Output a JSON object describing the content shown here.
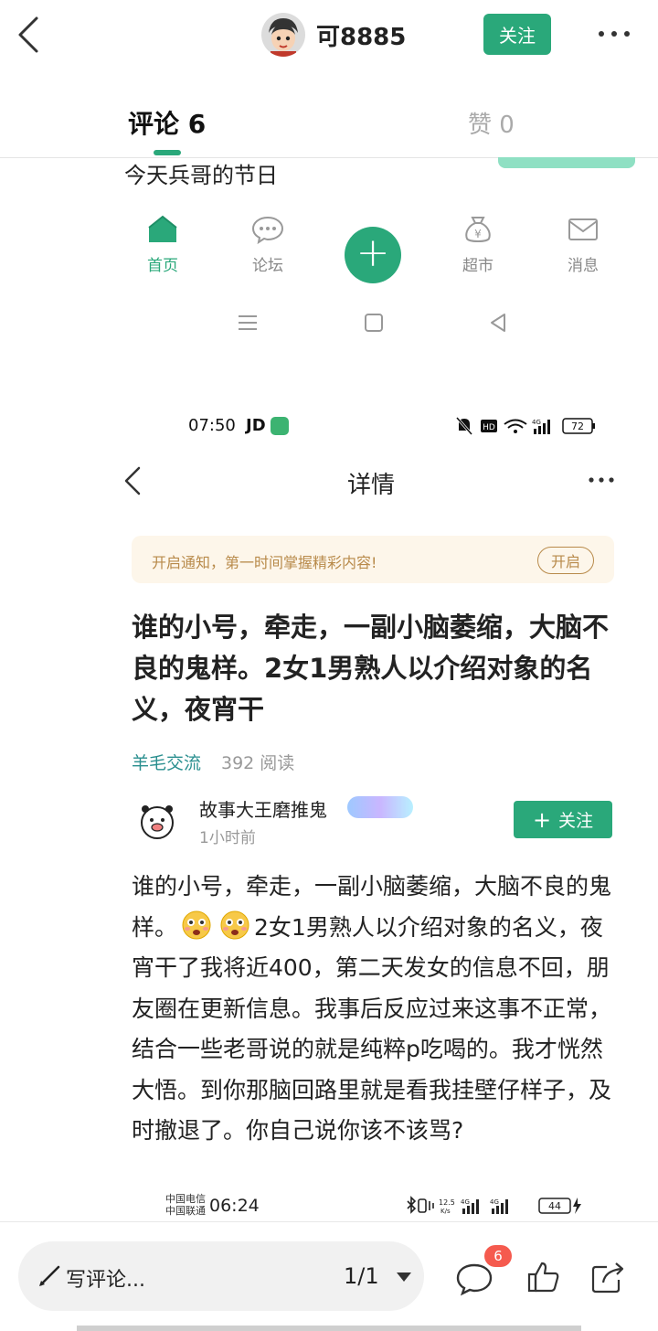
{
  "header": {
    "user_name": "可8885",
    "follow_label": "关注"
  },
  "tabs": {
    "comment_label": "评论 6",
    "like_label": "赞 0"
  },
  "embedded_top": {
    "snippet": "今天兵哥的节日",
    "nav": [
      {
        "label": "首页",
        "icon": "home-icon"
      },
      {
        "label": "论坛",
        "icon": "chat-bubble-icon"
      },
      {
        "label": "超市",
        "icon": "money-bag-icon"
      },
      {
        "label": "消息",
        "icon": "mail-icon"
      }
    ],
    "accent": "#2aa87a"
  },
  "status_bar_1": {
    "time": "07:50",
    "app": "JD",
    "battery": "72"
  },
  "detail": {
    "title": "详情",
    "notice_text": "开启通知，第一时间掌握精彩内容!",
    "notice_button": "开启",
    "post_title": "谁的小号，牵走，一副小脑萎缩，大脑不良的鬼样。2女1男熟人以介绍对象的名义，夜宵干",
    "forum": "羊毛交流",
    "read_count": "392 阅读",
    "author": "故事大王磨推鬼",
    "author_time": "1小时前",
    "follow_label": "关注",
    "body_part1": "谁的小号，牵走，一副小脑萎缩，大脑不良的鬼样。",
    "body_part2": "2女1男熟人以介绍对象的名义，夜宵干了我将近400，第二天发女的信息不回，朋友圈在更新信息。我事后反应过来这事不正常，结合一些老哥说的就是纯粹p吃喝的。我才恍然大悟。到你那脑回路里就是看我挂壁仔样子，及时撤退了。你自己说你该不该骂?"
  },
  "status_bar_2": {
    "carrier_1": "中国电信",
    "carrier_2": "中国联通",
    "time": "06:24",
    "speed": "12.5",
    "speed_unit": "K/s",
    "battery": "44"
  },
  "bottom_bar": {
    "comment_placeholder": "写评论...",
    "page_indicator": "1/1",
    "comment_count": "6"
  }
}
